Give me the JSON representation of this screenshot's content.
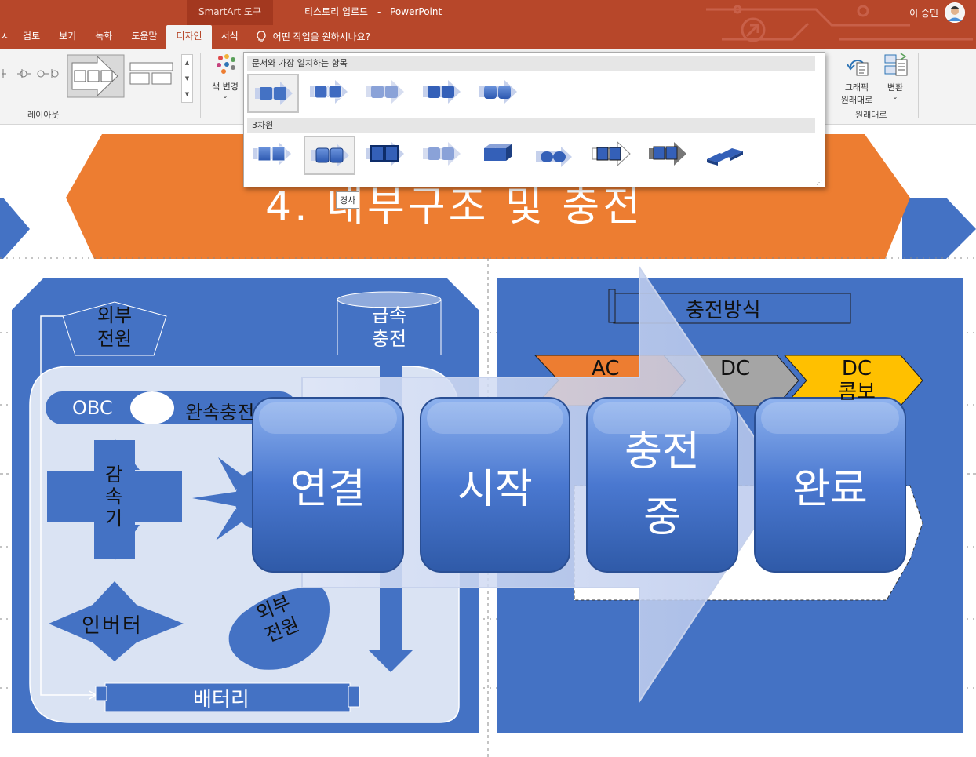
{
  "titlebar": {
    "tool_context": "SmartArt 도구",
    "doc_name": "티스토리 업로드",
    "separator": "-",
    "app_name": "PowerPoint",
    "user_name": "이 승민"
  },
  "tabs": [
    {
      "label": "ㅅ"
    },
    {
      "label": "검토"
    },
    {
      "label": "보기"
    },
    {
      "label": "녹화"
    },
    {
      "label": "도움말"
    },
    {
      "label": "디자인",
      "active": true
    },
    {
      "label": "서식"
    }
  ],
  "tellme": {
    "placeholder": "어떤 작업을 원하시나요?"
  },
  "ribbon": {
    "layout_group_label": "레이아웃",
    "color_change_label": "색 변경",
    "graphic_reset_label_1": "그래픽",
    "graphic_reset_label_2": "원래대로",
    "convert_label": "변환",
    "reset_group_label": "원래대로"
  },
  "style_popup": {
    "section1_title": "문서와 가장 일치하는 항목",
    "section2_title": "3차원",
    "tooltip": "경사"
  },
  "slide": {
    "title": "4. 내부구조 및 충전",
    "left_panel": {
      "external_power_1": "외부\n전원",
      "fast_charge": "급속\n충전",
      "obc": "OBC",
      "slow_charge": "완속충전",
      "reducer": "감\n속\n기",
      "inverter": "인버터",
      "external_power_2": "외부\n전원",
      "battery": "배터리"
    },
    "right_panel": {
      "scroll_title": "충전방식",
      "chevrons": [
        "AC",
        "DC",
        "DC\n콤보"
      ]
    },
    "process_steps": [
      "연결",
      "시작",
      "충전\n중",
      "완료"
    ]
  },
  "colors": {
    "title_bar": "#b7472a",
    "slide_orange": "#ed7d31",
    "slide_blue": "#4472c4",
    "light_panel": "#dae3f3",
    "yellow": "#ffc000",
    "gray": "#a5a5a5"
  }
}
